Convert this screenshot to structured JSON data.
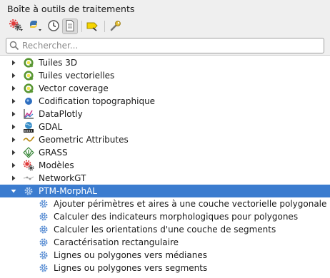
{
  "panel": {
    "title": "Boîte à outils de traitements"
  },
  "toolbar": {
    "buttons": [
      {
        "icon": "models-gear-icon",
        "has_menu": true
      },
      {
        "icon": "python-scripts-icon",
        "has_menu": true
      },
      {
        "icon": "history-clock-icon"
      },
      {
        "icon": "results-viewer-icon",
        "active": true
      },
      {
        "icon": "edit-features-in-place-icon"
      },
      {
        "icon": "options-wrench-icon"
      }
    ]
  },
  "search": {
    "placeholder": "Rechercher...",
    "value": ""
  },
  "tree": {
    "providers": [
      {
        "label": "Tuiles 3D",
        "icon": "qgis-icon",
        "expanded": false
      },
      {
        "label": "Tuiles vectorielles",
        "icon": "qgis-icon",
        "expanded": false
      },
      {
        "label": "Vector coverage",
        "icon": "qgis-icon",
        "expanded": false
      },
      {
        "label": "Codification topographique",
        "icon": "blue-dot-icon",
        "expanded": false
      },
      {
        "label": "DataPlotly",
        "icon": "dataplotly-icon",
        "expanded": false
      },
      {
        "label": "GDAL",
        "icon": "gdal-icon",
        "expanded": false
      },
      {
        "label": "Geometric Attributes",
        "icon": "wave-icon",
        "expanded": false
      },
      {
        "label": "GRASS",
        "icon": "grass-icon",
        "expanded": false
      },
      {
        "label": "Modèles",
        "icon": "models-icon",
        "expanded": false
      },
      {
        "label": "NetworkGT",
        "icon": "networkgt-icon",
        "expanded": false
      },
      {
        "label": "PTM-MorphAL",
        "icon": "gear-icon",
        "expanded": true,
        "selected": true
      }
    ],
    "algorithms": [
      {
        "label": "Ajouter périmètres et aires à une couche vectorielle polygonale",
        "icon": "gear-icon"
      },
      {
        "label": "Calculer des indicateurs morphologiques pour polygones",
        "icon": "gear-icon"
      },
      {
        "label": "Calculer les orientations d'une couche de segments",
        "icon": "gear-icon"
      },
      {
        "label": "Caractérisation rectangulaire",
        "icon": "gear-icon"
      },
      {
        "label": "Lignes ou polygones vers médianes",
        "icon": "gear-icon"
      },
      {
        "label": "Lignes ou polygones vers segments",
        "icon": "gear-icon"
      }
    ]
  },
  "colors": {
    "selection": "#3b7ccf",
    "qgis_green": "#589632",
    "qgis_yellow": "#f0e64a",
    "gear_blue": "#5b8fd4"
  }
}
